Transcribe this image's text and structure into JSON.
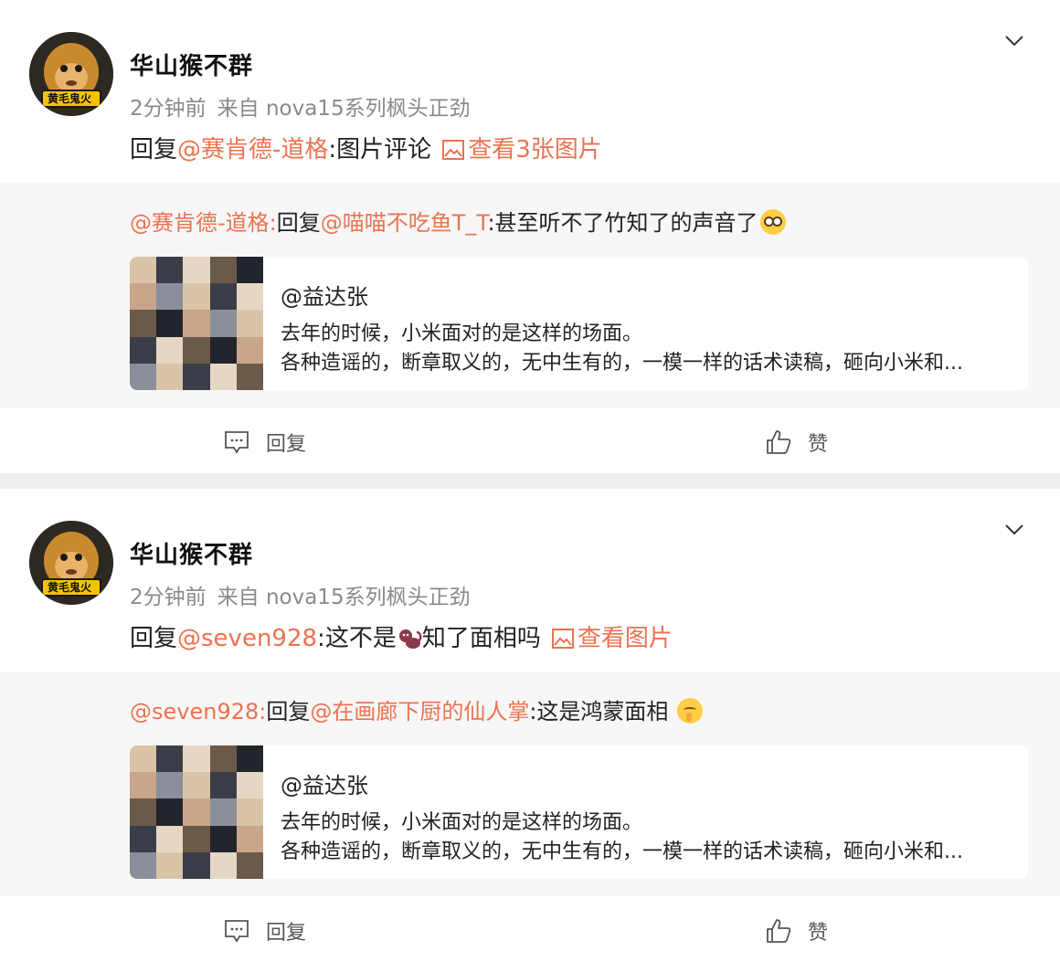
{
  "comments": [
    {
      "username": "华山猴不群",
      "avatar_text": "黄毛鬼火",
      "time": "2分钟前",
      "source": "来自 nova15系列枫头正劲",
      "reply_prefix": "回复",
      "reply_mention": "@赛肯德-道格",
      "reply_colon": ":",
      "reply_text_before": "图片评论",
      "reply_text_after": "",
      "view_images": "查看3张图片",
      "quote": {
        "author_mention": "@赛肯德-道格:",
        "reply_word": "回复",
        "reply_mention": "@喵喵不吃鱼T_T",
        "text": ":甚至听不了竹知了的声音了",
        "emoji": "wow-emoji"
      },
      "card": {
        "author": "@益达张",
        "line1": "去年的时候，小米面对的是这样的场面。",
        "line2": "各种造谣的，断章取义的，无中生有的，一模一样的话术读稿，砸向小米和..."
      },
      "reply_label": "回复",
      "like_label": "赞"
    },
    {
      "username": "华山猴不群",
      "avatar_text": "黄毛鬼火",
      "time": "2分钟前",
      "source": "来自 nova15系列枫头正劲",
      "reply_prefix": "回复",
      "reply_mention": "@seven928",
      "reply_colon": ":",
      "reply_text_before": "这不是",
      "reply_text_after": "知了面相吗",
      "view_images": "查看图片",
      "quote": {
        "author_mention": "@seven928:",
        "reply_word": "回复",
        "reply_mention": "@在画廊下厨的仙人掌",
        "text": ":这是鸿蒙面相",
        "emoji": "shush-emoji"
      },
      "card": {
        "author": "@益达张",
        "line1": "去年的时候，小米面对的是这样的场面。",
        "line2": "各种造谣的，断章取义的，无中生有的，一模一样的话术读稿，砸向小米和..."
      },
      "reply_label": "回复",
      "like_label": "赞"
    }
  ],
  "colors": {
    "accent": "#eb7350",
    "meta": "#8a8a8a",
    "quote_bg": "#f7f7f7",
    "divider": "#eeeeee"
  }
}
